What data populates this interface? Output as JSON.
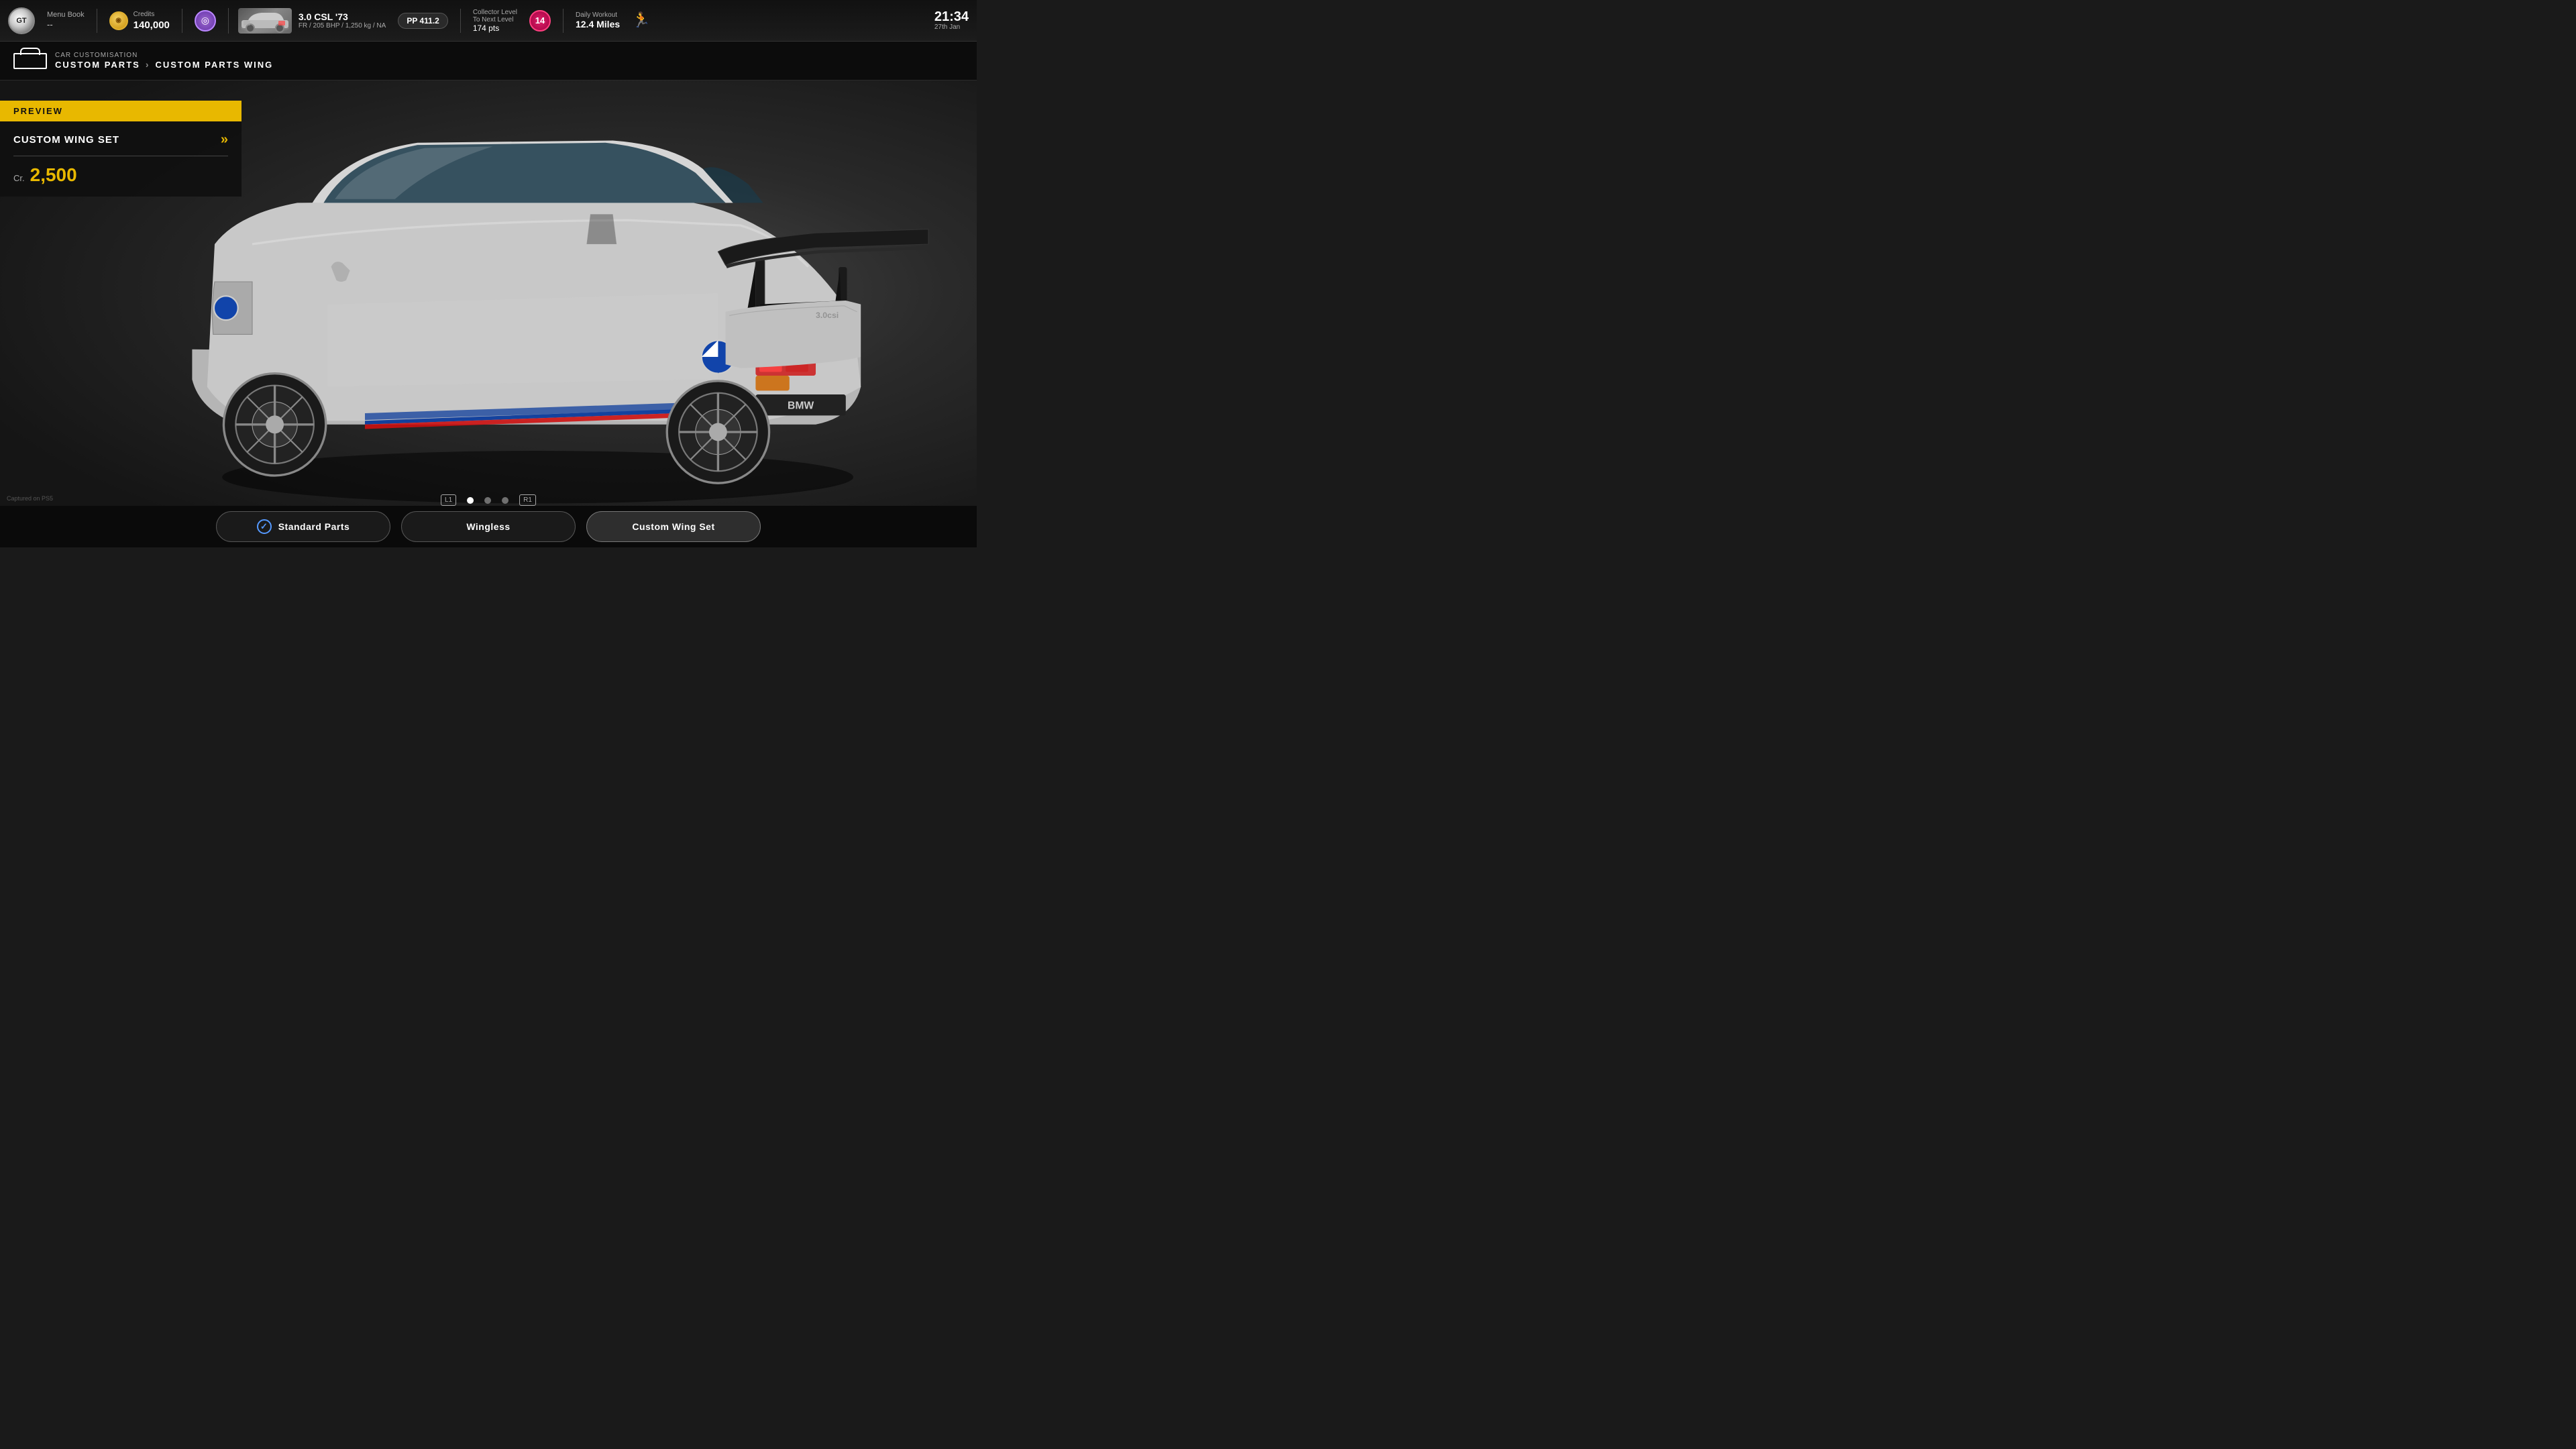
{
  "topbar": {
    "logo": "GT",
    "menu_book": {
      "label": "Menu Book",
      "value": "--"
    },
    "credits": {
      "label": "Credits",
      "amount": "140,000"
    },
    "car": {
      "name": "3.0 CSL '73",
      "specs": "FR / 205 BHP / 1,250 kg / NA"
    },
    "pp": "PP 411.2",
    "collector": {
      "label": "Collector Level",
      "next_label": "To Next Level",
      "pts": "174 pts",
      "level": "14"
    },
    "workout": {
      "label": "Daily Workout",
      "miles": "12.4 Miles"
    },
    "time": "21:34",
    "date": "27th Jan"
  },
  "breadcrumb": {
    "sub": "CAR CUSTOMISATION",
    "parts": "CUSTOM PARTS",
    "arrow": ">",
    "wing": "CUSTOM PARTS WING"
  },
  "preview": {
    "banner": "PREVIEW",
    "title": "CUSTOM WING SET",
    "price_label": "Cr.",
    "price": "2,500"
  },
  "dots": {
    "active_index": 0,
    "count": 3
  },
  "buttons": {
    "left_button": "L1",
    "right_button": "R1",
    "standard_parts": "Standard Parts",
    "wingless": "Wingless",
    "custom_wing_set": "Custom Wing Set"
  },
  "captured": "Captured on PS5"
}
